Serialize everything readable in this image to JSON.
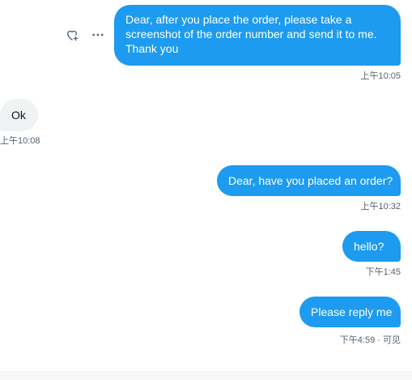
{
  "messages": [
    {
      "direction": "out",
      "text": "Dear, after you place the order, please take a screenshot of the order number and send it to me. Thank you",
      "time": "上午10:05"
    },
    {
      "direction": "in",
      "text": "Ok",
      "time": "上午10:08"
    },
    {
      "direction": "out",
      "text": "Dear, have you placed an order?",
      "time": "上午10:32"
    },
    {
      "direction": "out",
      "text": "hello?",
      "time": "下午1:45"
    },
    {
      "direction": "out",
      "text": "Please reply me",
      "time": "下午4:59 · 可见"
    }
  ],
  "actions": {
    "react_icon": "heart-plus-icon",
    "more_icon": "more-horizontal-icon"
  },
  "colors": {
    "outgoing_bubble": "#1d9bf0",
    "incoming_bubble": "#eff3f4",
    "meta_text": "#536471"
  }
}
